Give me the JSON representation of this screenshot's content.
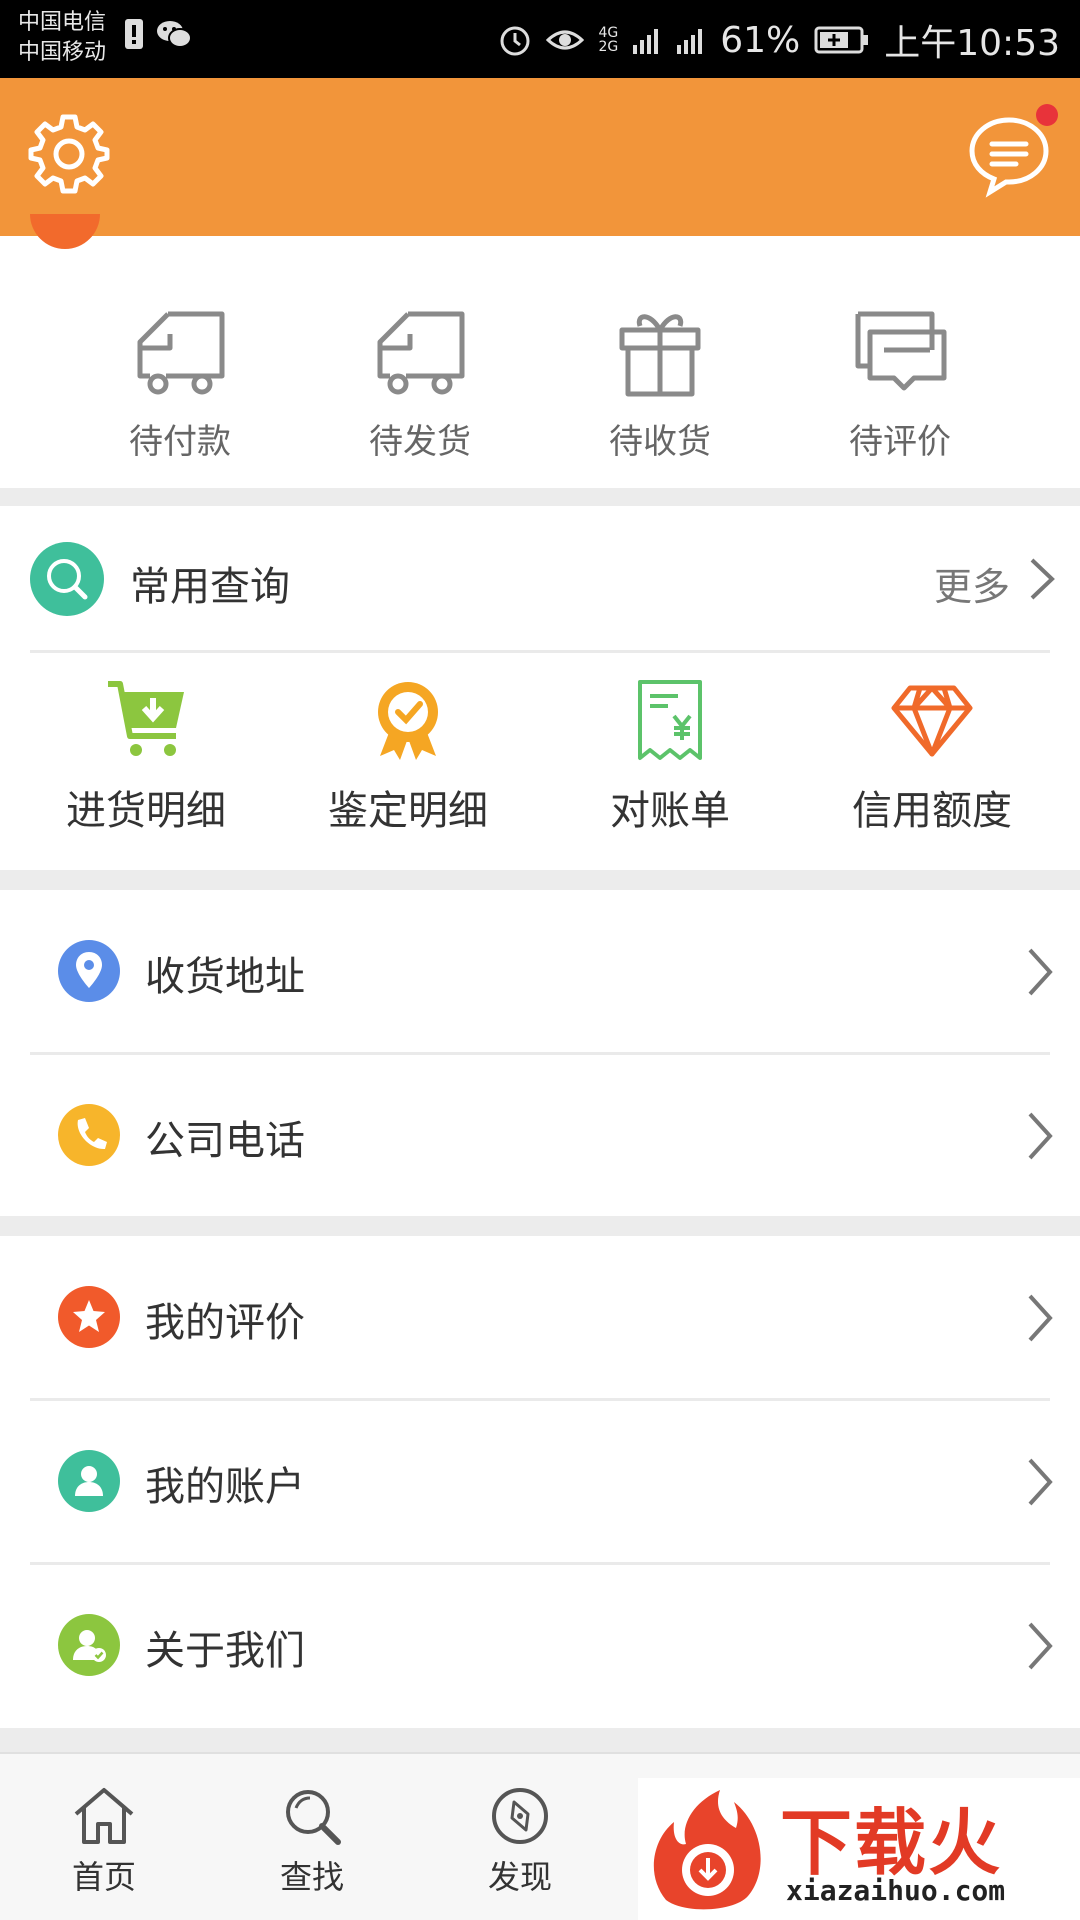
{
  "status_bar": {
    "carrier1": "中国电信",
    "carrier2": "中国移动",
    "net1": "4G",
    "net2": "2G",
    "battery": "61%",
    "time": "上午10:53"
  },
  "header": {
    "settings_icon": "gear-icon",
    "message_icon": "chat-bubble-icon",
    "accent_color": "#f2953a",
    "badge_color": "#e8333a"
  },
  "orders": [
    {
      "label": "待付款",
      "icon": "truck-icon"
    },
    {
      "label": "待发货",
      "icon": "truck-icon"
    },
    {
      "label": "待收货",
      "icon": "gift-box-icon"
    },
    {
      "label": "待评价",
      "icon": "comment-icon"
    }
  ],
  "queries": {
    "title": "常用查询",
    "more": "更多",
    "items": [
      {
        "label": "进货明细",
        "icon": "cart-download-icon",
        "color": "#8cc63f"
      },
      {
        "label": "鉴定明细",
        "icon": "badge-check-icon",
        "color": "#f5a623"
      },
      {
        "label": "对账单",
        "icon": "receipt-icon",
        "color": "#5cc36a"
      },
      {
        "label": "信用额度",
        "icon": "diamond-icon",
        "color": "#f06a2a"
      }
    ]
  },
  "list1": [
    {
      "label": "收货地址",
      "icon": "location-pin-icon",
      "color": "#5b8de8"
    },
    {
      "label": "公司电话",
      "icon": "phone-icon",
      "color": "#f7b52b"
    }
  ],
  "list2": [
    {
      "label": "我的评价",
      "icon": "star-icon",
      "color": "#f15a2b"
    },
    {
      "label": "我的账户",
      "icon": "user-icon",
      "color": "#3fbf9b"
    },
    {
      "label": "关于我们",
      "icon": "user-check-icon",
      "color": "#8cc63f"
    }
  ],
  "bottom_nav": [
    {
      "label": "首页",
      "icon": "home-icon"
    },
    {
      "label": "查找",
      "icon": "search-icon"
    },
    {
      "label": "发现",
      "icon": "compass-icon"
    }
  ],
  "watermark": {
    "brand": "下载火",
    "url": "xiazaihuo.com"
  }
}
